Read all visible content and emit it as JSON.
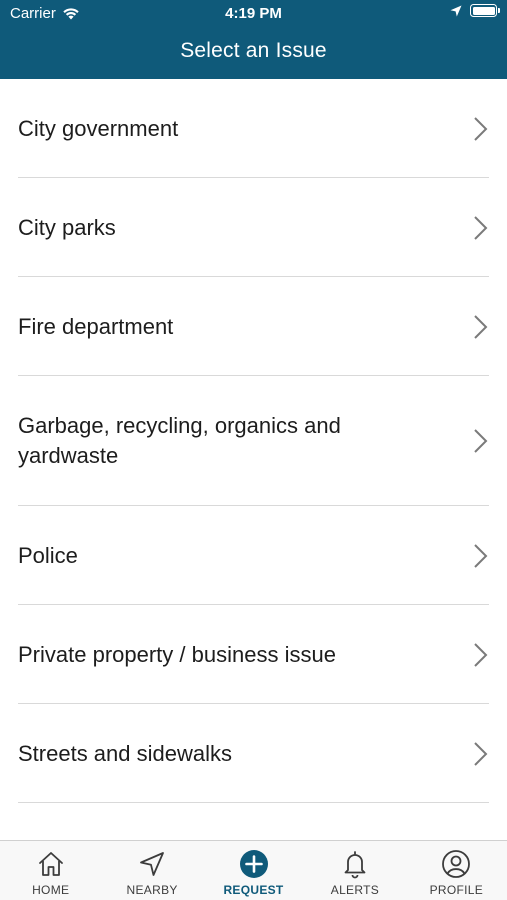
{
  "status_bar": {
    "carrier": "Carrier",
    "time": "4:19 PM"
  },
  "header": {
    "title": "Select an Issue",
    "background_color": "#0f5a7a"
  },
  "issues": [
    {
      "label": "City government",
      "icon": "chevron-right-icon"
    },
    {
      "label": "City parks",
      "icon": "chevron-right-icon"
    },
    {
      "label": "Fire department",
      "icon": "chevron-right-icon"
    },
    {
      "label": "Garbage, recycling, organics and yardwaste",
      "icon": "chevron-right-icon"
    },
    {
      "label": "Police",
      "icon": "chevron-right-icon"
    },
    {
      "label": "Private property / business issue",
      "icon": "chevron-right-icon"
    },
    {
      "label": "Streets and sidewalks",
      "icon": "chevron-right-icon"
    }
  ],
  "tabbar": {
    "active_color": "#0f5a7a",
    "tabs": [
      {
        "label": "HOME",
        "icon": "home-icon",
        "active": false
      },
      {
        "label": "NEARBY",
        "icon": "location-arrow-icon",
        "active": false
      },
      {
        "label": "REQUEST",
        "icon": "plus-circle-icon",
        "active": true
      },
      {
        "label": "ALERTS",
        "icon": "bell-icon",
        "active": false
      },
      {
        "label": "PROFILE",
        "icon": "user-circle-icon",
        "active": false
      }
    ]
  }
}
